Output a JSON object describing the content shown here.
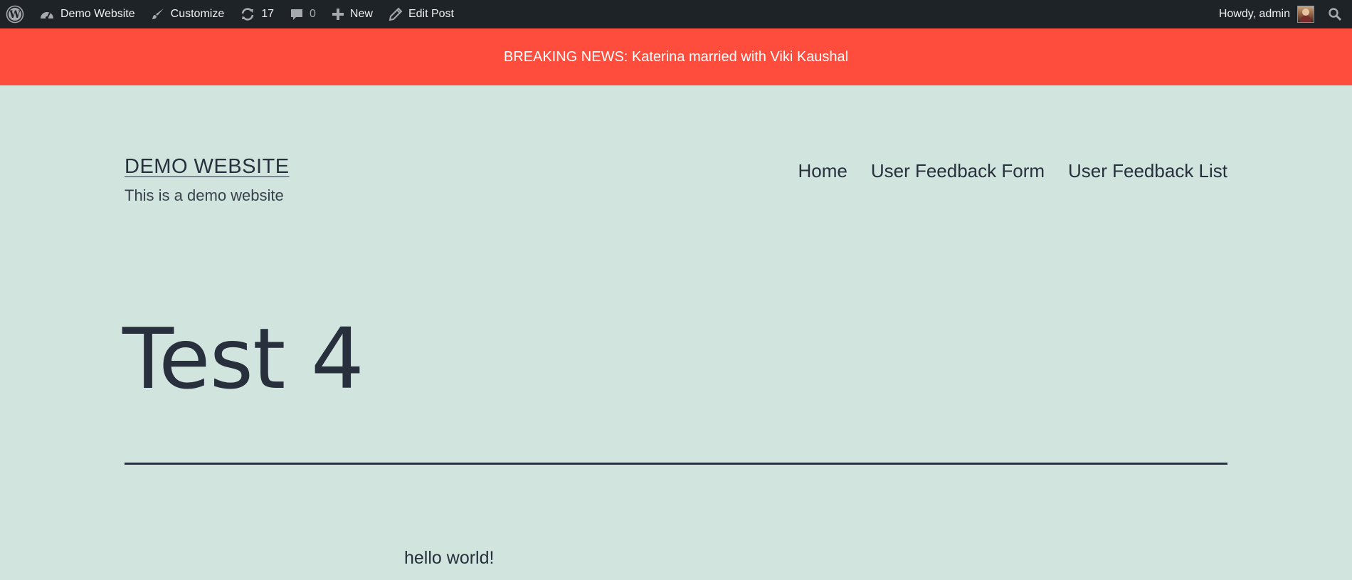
{
  "admin_bar": {
    "site_name": "Demo Website",
    "customize": "Customize",
    "updates_count": "17",
    "comments_count": "0",
    "new": "New",
    "edit_post": "Edit Post",
    "howdy": "Howdy, admin"
  },
  "breaking_news": "BREAKING NEWS: Katerina married with Viki Kaushal",
  "header": {
    "site_title": "DEMO WEBSITE",
    "tagline": "This is a demo website",
    "nav": [
      "Home",
      "User Feedback Form",
      "User Feedback List"
    ]
  },
  "post": {
    "title": "Test 4",
    "content": "hello world!"
  },
  "colors": {
    "admin_bar_bg": "#1d2327",
    "breaking_bg": "#ff4d3d",
    "page_bg": "#d1e4dd",
    "text": "#28303d"
  }
}
